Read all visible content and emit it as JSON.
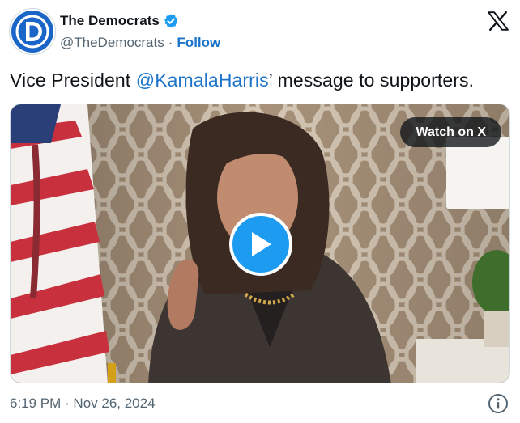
{
  "author": {
    "name": "The Democrats",
    "handle": "@TheDemocrats",
    "separator": "·",
    "follow_label": "Follow",
    "avatar_icon": "democrats-logo-icon",
    "verified_icon": "verified-badge-icon"
  },
  "platform_icon": "x-logo-icon",
  "tweet": {
    "text_before": "Vice President ",
    "mention": "@KamalaHarris",
    "text_after": "’ message to supporters."
  },
  "media": {
    "watch_label": "Watch on X",
    "play_icon": "play-icon"
  },
  "footer": {
    "timestamp": "6:19 PM · Nov 26, 2024",
    "info_icon": "info-icon"
  },
  "colors": {
    "link": "#1d75cb",
    "play": "#1d9bf0",
    "secondary_text": "#536471",
    "avatar": "#1a65c8"
  }
}
